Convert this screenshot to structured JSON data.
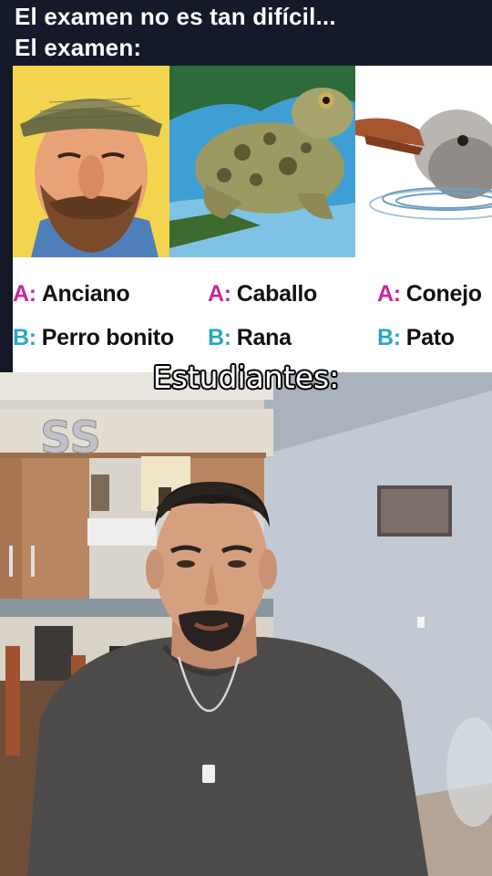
{
  "header": {
    "line1": "El examen no es tan difícil...",
    "line2": "El examen:"
  },
  "quiz": {
    "images": [
      {
        "subject": "elderly-man-illustration"
      },
      {
        "subject": "toad-illustration"
      },
      {
        "subject": "duck-illustration"
      }
    ],
    "options": [
      {
        "a_letter": "A:",
        "a_text": "Anciano",
        "b_letter": "B:",
        "b_text": "Perro bonito"
      },
      {
        "a_letter": "A:",
        "a_text": "Caballo",
        "b_letter": "B:",
        "b_text": "Rana"
      },
      {
        "a_letter": "A:",
        "a_text": "Conejo",
        "b_letter": "B:",
        "b_text": "Pato"
      }
    ],
    "colors": {
      "letter_a": "#c8279a",
      "letter_b": "#27a7c8"
    }
  },
  "video": {
    "caption": "Estudiantes:",
    "wall_decor": "SS"
  }
}
